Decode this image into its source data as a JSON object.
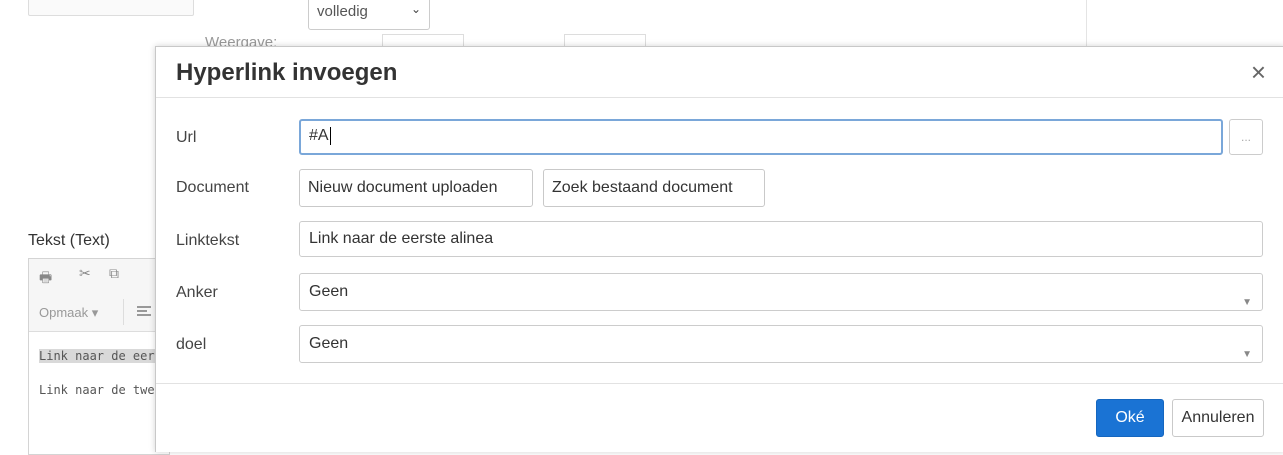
{
  "background": {
    "view_select_value": "volledig",
    "weergave_label": "Weergave:",
    "text_section_label": "Tekst (Text)",
    "toolbar_format_label": "Opmaak",
    "editor_lines": [
      "Link naar de eer",
      "Link naar de twe"
    ]
  },
  "dialog": {
    "title": "Hyperlink invoegen",
    "close_symbol": "×",
    "url": {
      "label": "Url",
      "value": "#A",
      "browse_label": "..."
    },
    "document": {
      "label": "Document",
      "upload_label": "Nieuw document uploaden",
      "search_label": "Zoek bestaand document"
    },
    "linktext": {
      "label": "Linktekst",
      "value": "Link naar de eerste alinea"
    },
    "anchor": {
      "label": "Anker",
      "value": "Geen"
    },
    "target": {
      "label": "doel",
      "value": "Geen"
    },
    "ok_label": "Oké",
    "cancel_label": "Annuleren"
  },
  "colors": {
    "primary": "#1a73d4",
    "focus_border": "#7aa7d9"
  },
  "icons": [
    "print-icon",
    "cut-icon",
    "copy-icon",
    "align-left-icon",
    "close-icon",
    "chevron-down-icon"
  ]
}
